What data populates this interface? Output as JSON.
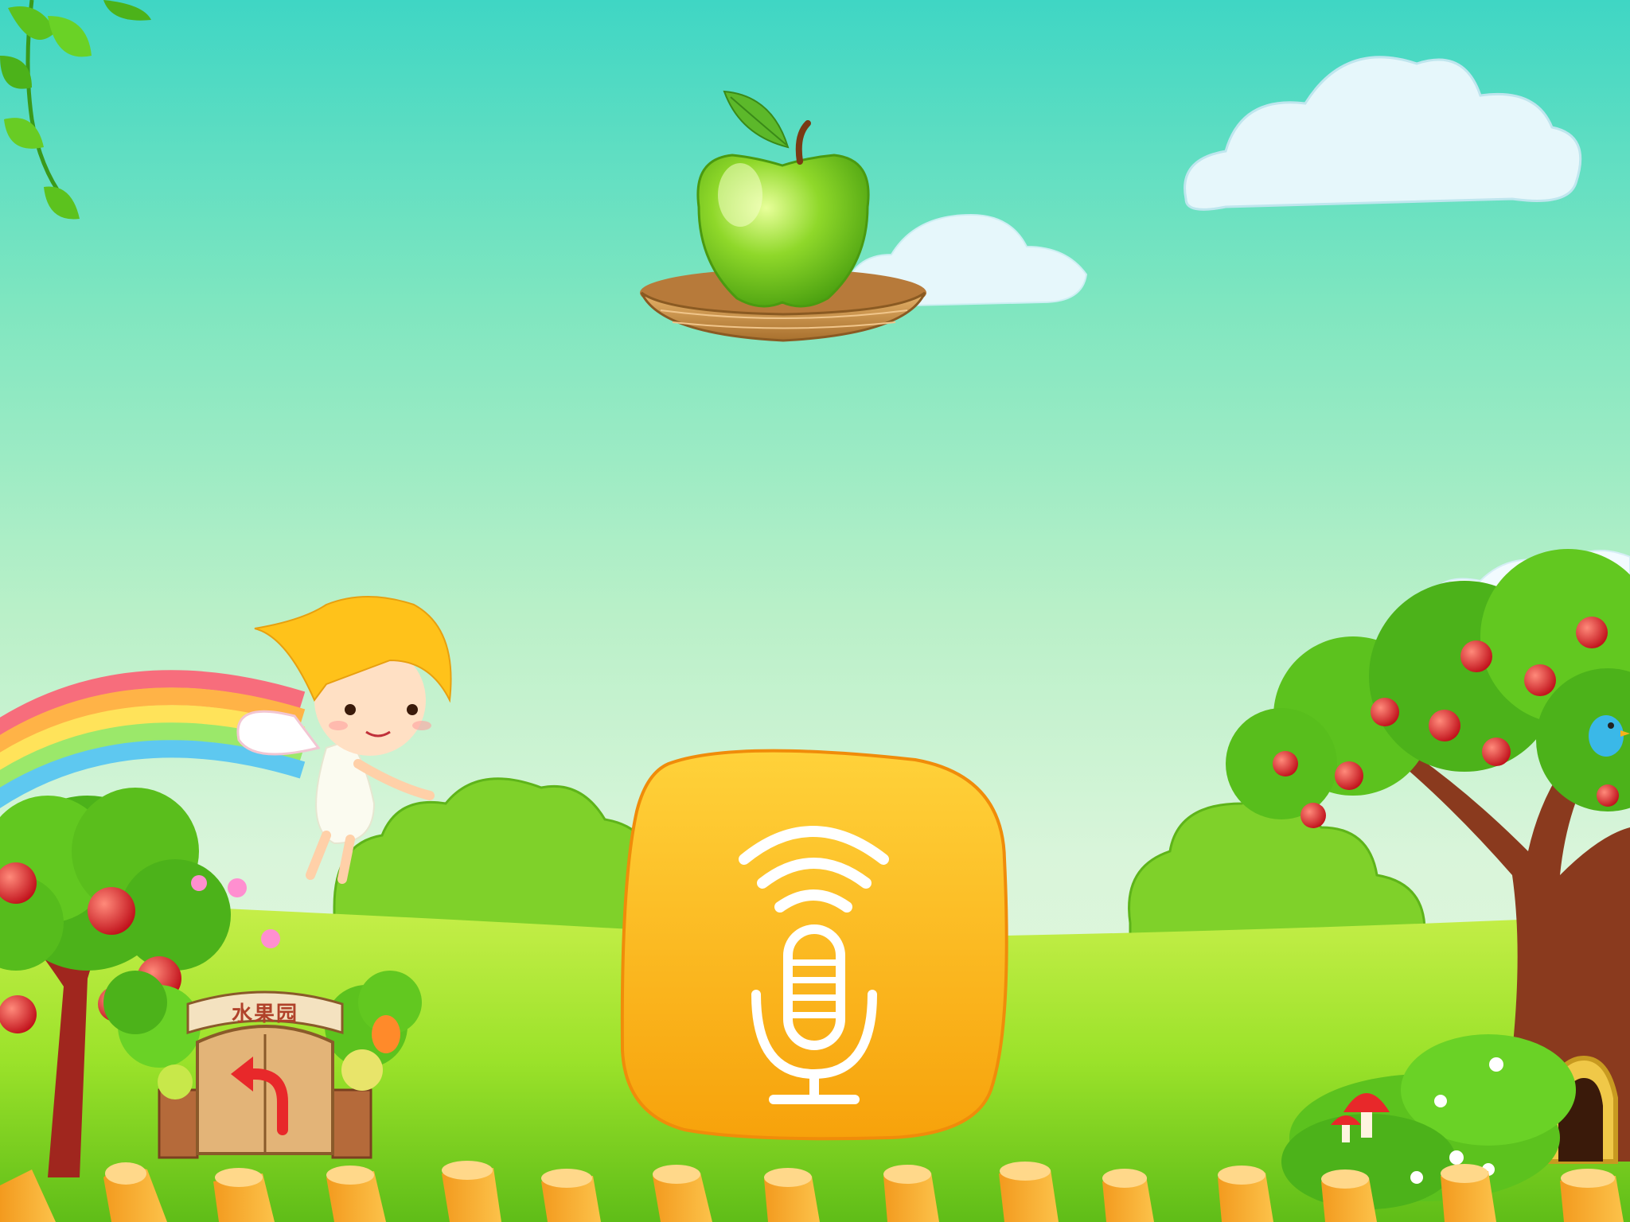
{
  "game": {
    "target_fruit": "green-apple-icon",
    "gate_label": "水果园",
    "back_button_icon": "back-arrow-icon",
    "mic_button_icon": "microphone-icon"
  },
  "colors": {
    "sky_top": "#3fd6c4",
    "grass": "#9be22a",
    "mic_button": "#fbb414",
    "apple_green": "#7fcc1c",
    "back_arrow": "#e8282a"
  }
}
